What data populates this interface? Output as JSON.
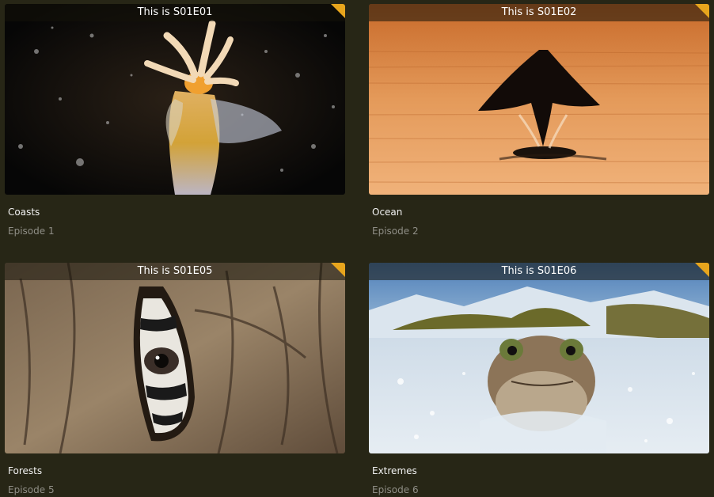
{
  "episodes": [
    {
      "overlay": "This is S01E01",
      "title": "Coasts",
      "subtitle": "Episode 1",
      "image": "glowing-sea-creature-image"
    },
    {
      "overlay": "This is S01E02",
      "title": "Ocean",
      "subtitle": "Episode 2",
      "image": "ray-leaping-at-sunset-image"
    },
    {
      "overlay": "This is S01E05",
      "title": "Forests",
      "subtitle": "Episode 5",
      "image": "animal-eye-in-tree-hollow-image"
    },
    {
      "overlay": "This is S01E06",
      "title": "Extremes",
      "subtitle": "Episode 6",
      "image": "frog-in-icy-water-image"
    }
  ],
  "colors": {
    "background": "#272616",
    "flag": "#e7a51d",
    "title": "#f2f2f2",
    "subtitle": "#8f8e86"
  }
}
